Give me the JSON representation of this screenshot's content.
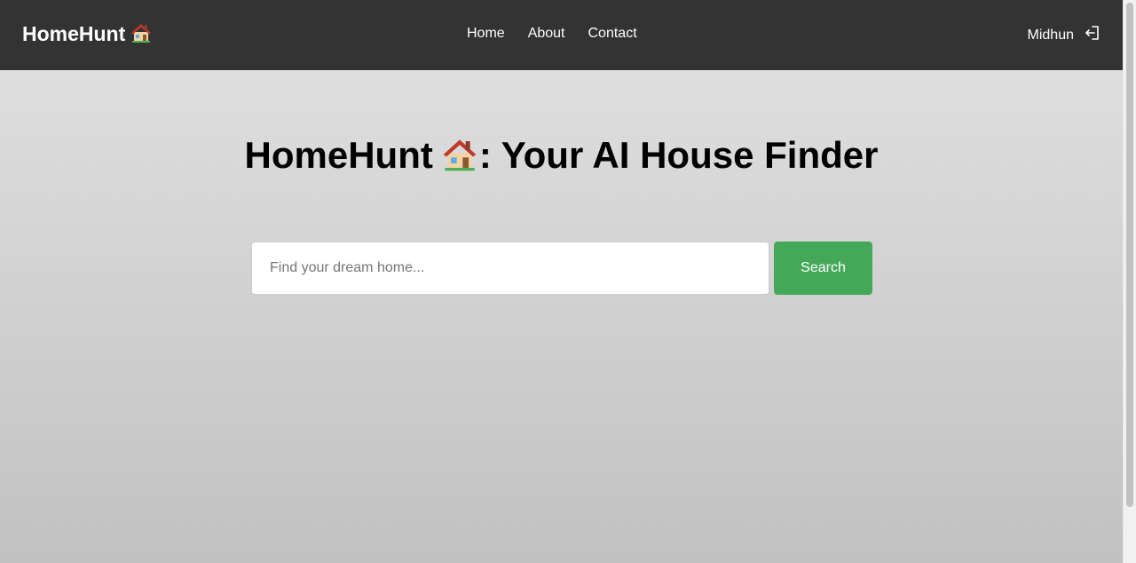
{
  "navbar": {
    "brand": "HomeHunt",
    "links": [
      {
        "label": "Home"
      },
      {
        "label": "About"
      },
      {
        "label": "Contact"
      }
    ],
    "user_name": "Midhun",
    "logout_icon": "logout-icon",
    "brand_icon": "house-icon",
    "background_color": "#333333"
  },
  "hero": {
    "title_before": "HomeHunt",
    "title_after": ": Your AI House Finder",
    "title_icon": "house-icon"
  },
  "search": {
    "placeholder": "Find your dream home...",
    "value": "",
    "button_label": "Search",
    "button_color": "#45a858"
  }
}
